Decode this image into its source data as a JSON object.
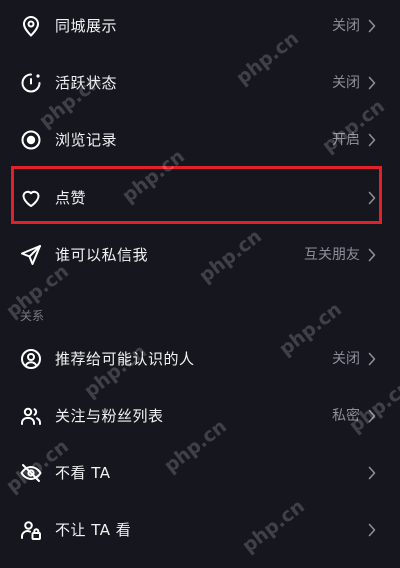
{
  "settings": {
    "items": [
      {
        "label": "同城展示",
        "value": "关闭",
        "icon": "location-pin-icon"
      },
      {
        "label": "活跃状态",
        "value": "关闭",
        "icon": "activity-status-icon"
      },
      {
        "label": "浏览记录",
        "value": "开启",
        "icon": "eye-icon"
      },
      {
        "label": "点赞",
        "value": "",
        "icon": "heart-icon"
      },
      {
        "label": "谁可以私信我",
        "value": "互关朋友",
        "icon": "send-icon"
      }
    ],
    "relations_header": "关系",
    "relations": [
      {
        "label": "推荐给可能认识的人",
        "value": "关闭",
        "icon": "person-circle-icon"
      },
      {
        "label": "关注与粉丝列表",
        "value": "私密",
        "icon": "users-icon"
      },
      {
        "label": "不看 TA",
        "value": "",
        "icon": "eye-off-icon"
      },
      {
        "label": "不让 TA 看",
        "value": "",
        "icon": "user-lock-icon"
      }
    ]
  },
  "watermark": "php.cn",
  "colors": {
    "background": "#16161e",
    "highlight": "#e0212c",
    "label": "#f2f2f4",
    "value": "#8d8d97"
  }
}
